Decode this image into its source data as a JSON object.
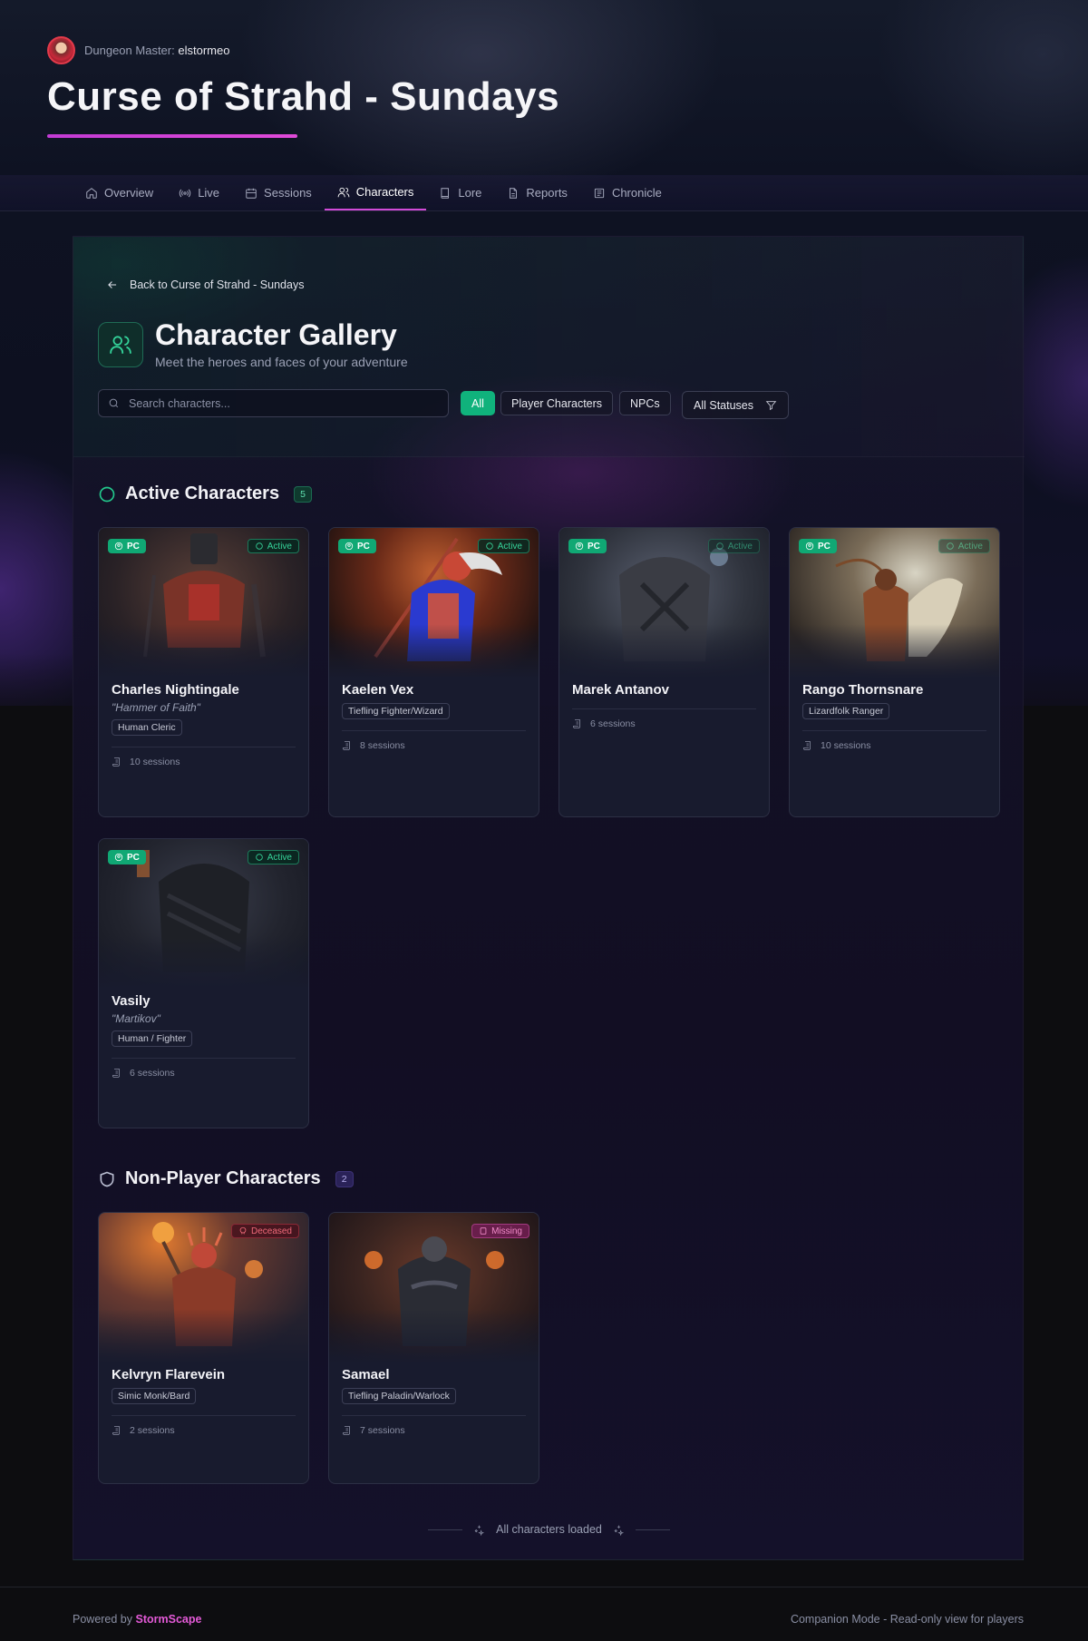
{
  "header": {
    "dm_label": "Dungeon Master:",
    "dm_name": "elstormeo",
    "campaign_title": "Curse of Strahd - Sundays"
  },
  "nav": {
    "items": [
      {
        "label": "Overview",
        "icon": "home-icon"
      },
      {
        "label": "Live",
        "icon": "broadcast-icon"
      },
      {
        "label": "Sessions",
        "icon": "calendar-icon"
      },
      {
        "label": "Characters",
        "icon": "users-icon",
        "active": true
      },
      {
        "label": "Lore",
        "icon": "book-icon"
      },
      {
        "label": "Reports",
        "icon": "file-icon"
      },
      {
        "label": "Chronicle",
        "icon": "newspaper-icon"
      }
    ]
  },
  "gallery": {
    "back_label": "Back to Curse of Strahd - Sundays",
    "title": "Character Gallery",
    "subtitle": "Meet the heroes and faces of your adventure",
    "search_placeholder": "Search characters...",
    "filters": [
      "All",
      "Player Characters",
      "NPCs"
    ],
    "active_filter": "All",
    "status_select": "All Statuses"
  },
  "sections": {
    "active": {
      "title": "Active Characters",
      "count": "5",
      "cards": [
        {
          "name": "Charles Nightingale",
          "quote": "\"Hammer of Faith\"",
          "role": "Human Cleric",
          "sessions": "10 sessions",
          "type": "PC",
          "status": "Active"
        },
        {
          "name": "Kaelen Vex",
          "quote": "",
          "role": "Tiefling Fighter/Wizard",
          "sessions": "8 sessions",
          "type": "PC",
          "status": "Active"
        },
        {
          "name": "Marek Antanov",
          "quote": "",
          "role": "",
          "sessions": "6 sessions",
          "type": "PC",
          "status": "Active"
        },
        {
          "name": "Rango Thornsnare",
          "quote": "",
          "role": "Lizardfolk Ranger",
          "sessions": "10 sessions",
          "type": "PC",
          "status": "Active"
        },
        {
          "name": "Vasily",
          "quote": "\"Martikov\"",
          "role": "Human / Fighter",
          "sessions": "6 sessions",
          "type": "PC",
          "status": "Active"
        }
      ]
    },
    "npc": {
      "title": "Non-Player Characters",
      "count": "2",
      "cards": [
        {
          "name": "Kelvryn Flarevein",
          "role": "Simic Monk/Bard",
          "sessions": "2 sessions",
          "status": "Deceased"
        },
        {
          "name": "Samael",
          "role": "Tiefling Paladin/Warlock",
          "sessions": "7 sessions",
          "status": "Missing"
        }
      ]
    }
  },
  "loaded_text": "All characters loaded",
  "footer": {
    "powered_by": "Powered by",
    "brand": "StormScape",
    "mode": "Companion Mode - Read-only view for players"
  },
  "colors": {
    "accent_green": "#10b27c",
    "accent_magenta": "#d24ad8",
    "deceased": "#f06a7a",
    "missing": "#f08ac8"
  }
}
